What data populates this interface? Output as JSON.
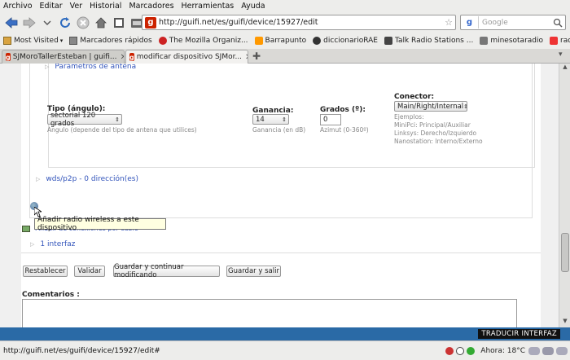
{
  "menu": [
    "Archivo",
    "Editar",
    "Ver",
    "Historial",
    "Marcadores",
    "Herramientas",
    "Ayuda"
  ],
  "address": {
    "url": "http://guifi.net/es/guifi/device/15927/edit"
  },
  "search": {
    "placeholder": "Google",
    "engine_letter": "g"
  },
  "bookmarks": [
    "Most Visited",
    "Marcadores rápidos",
    "The Mozilla Organiz...",
    "Barrapunto",
    "diccionarioRAE",
    "Talk Radio Stations ...",
    "minesotaradio",
    "radio FIP"
  ],
  "tabs": [
    {
      "label": "SJMoroTallerEsteban | guifi...",
      "active": false
    },
    {
      "label": "modificar dispositivo SJMor...",
      "active": true
    }
  ],
  "form": {
    "legend_antena": "Parámetros de antena",
    "tipo_label": "Tipo (ángulo):",
    "tipo_value": "sectorial 120 grados",
    "tipo_hint": "Ángulo (depende del tipo de antena que utilices)",
    "ganancia_label": "Ganancia:",
    "ganancia_value": "14",
    "ganancia_hint": "Ganancia (en dB)",
    "grados_label": "Grados (º):",
    "grados_value": "0",
    "grados_hint": "Azimut (0-360º)",
    "conector_label": "Conector:",
    "conector_value": "Main/Right/Internal",
    "conector_hint_1": "Ejemplos:",
    "conector_hint_2": "MiniPci: Principal/Auxiliar",
    "conector_hint_3": "Linksys: Derecho/Izquierdo",
    "conector_hint_4": "Nanostation: Interno/Externo",
    "wds_legend": "wds/p2p - 0 dirección(es)",
    "tooltip": "Añadir radio wireless a este dispositivo",
    "hidden_text": "Añadir de conexiones por cable",
    "interfaz_legend": "1 interfaz",
    "btn_reset": "Restablecer",
    "btn_validate": "Validar",
    "btn_save_continue": "Guardar y continuar modificando",
    "btn_save_exit": "Guardar y salir",
    "comments_label": "Comentarios :"
  },
  "translate_button": "TRADUCIR INTERFAZ",
  "status": {
    "url": "http://guifi.net/es/guifi/device/15927/edit#",
    "weather": "Ahora: 18°C"
  }
}
